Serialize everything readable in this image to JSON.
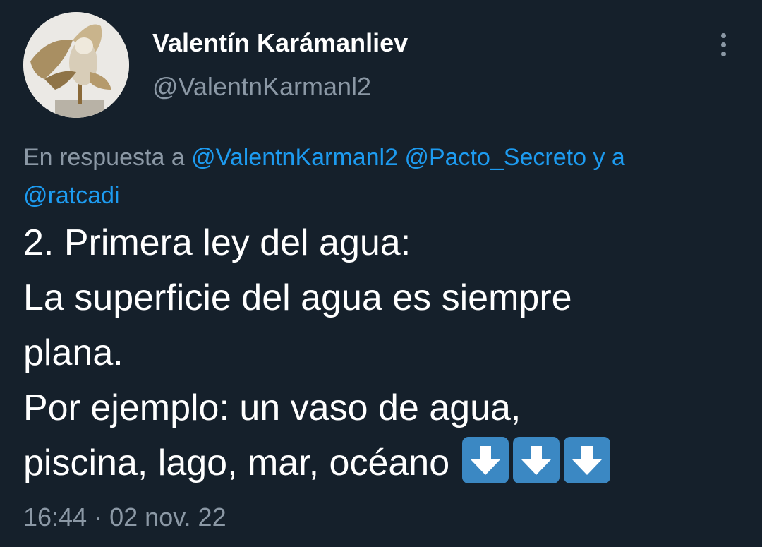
{
  "author": {
    "display_name": "Valentín Karámanliev",
    "handle": "@ValentnKarmanl2",
    "avatar_icon": "owl-sculpture-avatar"
  },
  "more_icon": "more-options-icon",
  "reply": {
    "prefix": "En respuesta a",
    "mention_1": "@ValentnKarmanl2",
    "mention_2": "@Pacto_Secreto",
    "connector": "y a",
    "mention_3": "@ratcadi"
  },
  "tweet": {
    "lines": [
      "2. Primera ley del agua:",
      "La superficie del agua es siempre",
      "plana.",
      "Por ejemplo: un vaso de agua,",
      "piscina, lago, mar, océano"
    ],
    "emojis": [
      "down-arrow-emoji",
      "down-arrow-emoji",
      "down-arrow-emoji"
    ]
  },
  "meta": {
    "time": "16:44",
    "separator": "·",
    "date": "02 nov. 22"
  },
  "colors": {
    "background": "#15202b",
    "text": "#ffffff",
    "muted": "#8b98a5",
    "link": "#1d9bf0",
    "emoji_blue": "#3b88c3"
  }
}
